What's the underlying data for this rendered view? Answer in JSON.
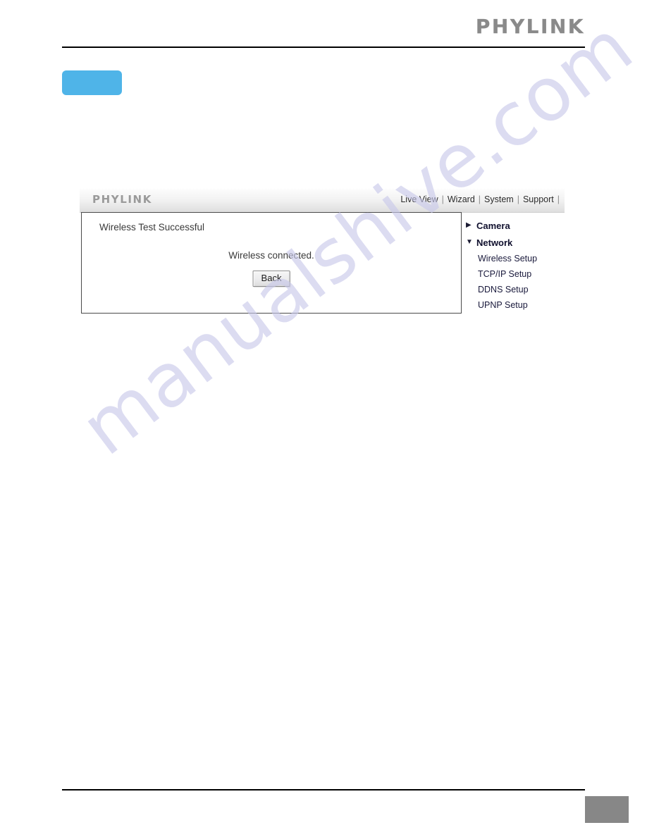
{
  "document": {
    "brand": "PHYLINK",
    "page_number": "",
    "watermark": "manualshive.com"
  },
  "step_badge": {
    "label": ""
  },
  "webui": {
    "logo": "PHYLINK",
    "nav": {
      "items": [
        "Live View",
        "Wizard",
        "System",
        "Support"
      ],
      "separator": "|"
    },
    "content": {
      "title": "Wireless Test Successful",
      "message": "Wireless connected.",
      "back_label": "Back"
    },
    "menu": [
      {
        "label": "Camera",
        "arrow": "▶",
        "expanded": false,
        "children": []
      },
      {
        "label": "Network",
        "arrow": "▼",
        "expanded": true,
        "children": [
          "Wireless Setup",
          "TCP/IP Setup",
          "DDNS Setup",
          "UPNP Setup"
        ]
      }
    ]
  },
  "colors": {
    "badge_blue": "#4fb4e8",
    "page_number_gray": "#878787",
    "watermark_lavender": "#c8c8ea",
    "logo_gray": "#8a8a8a"
  }
}
